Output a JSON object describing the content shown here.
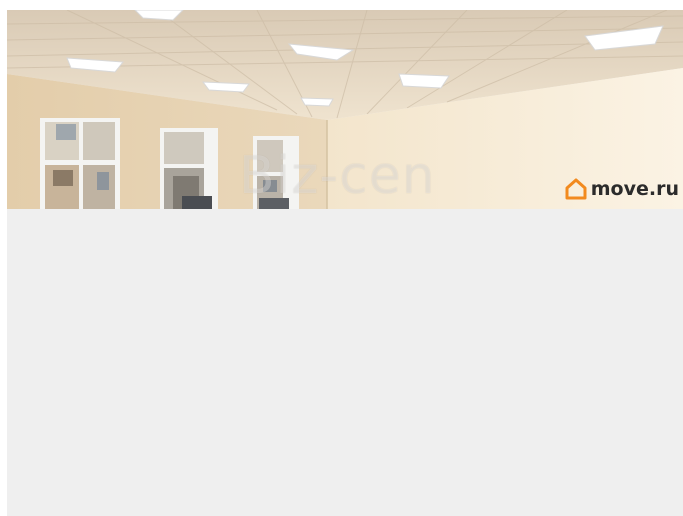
{
  "photo": {
    "watermark": "Biz-cen",
    "brand": "move.ru",
    "brand_color": "#f28a1e",
    "background_color": "#efefef"
  },
  "icons": {
    "logo": "house-logo-icon"
  }
}
